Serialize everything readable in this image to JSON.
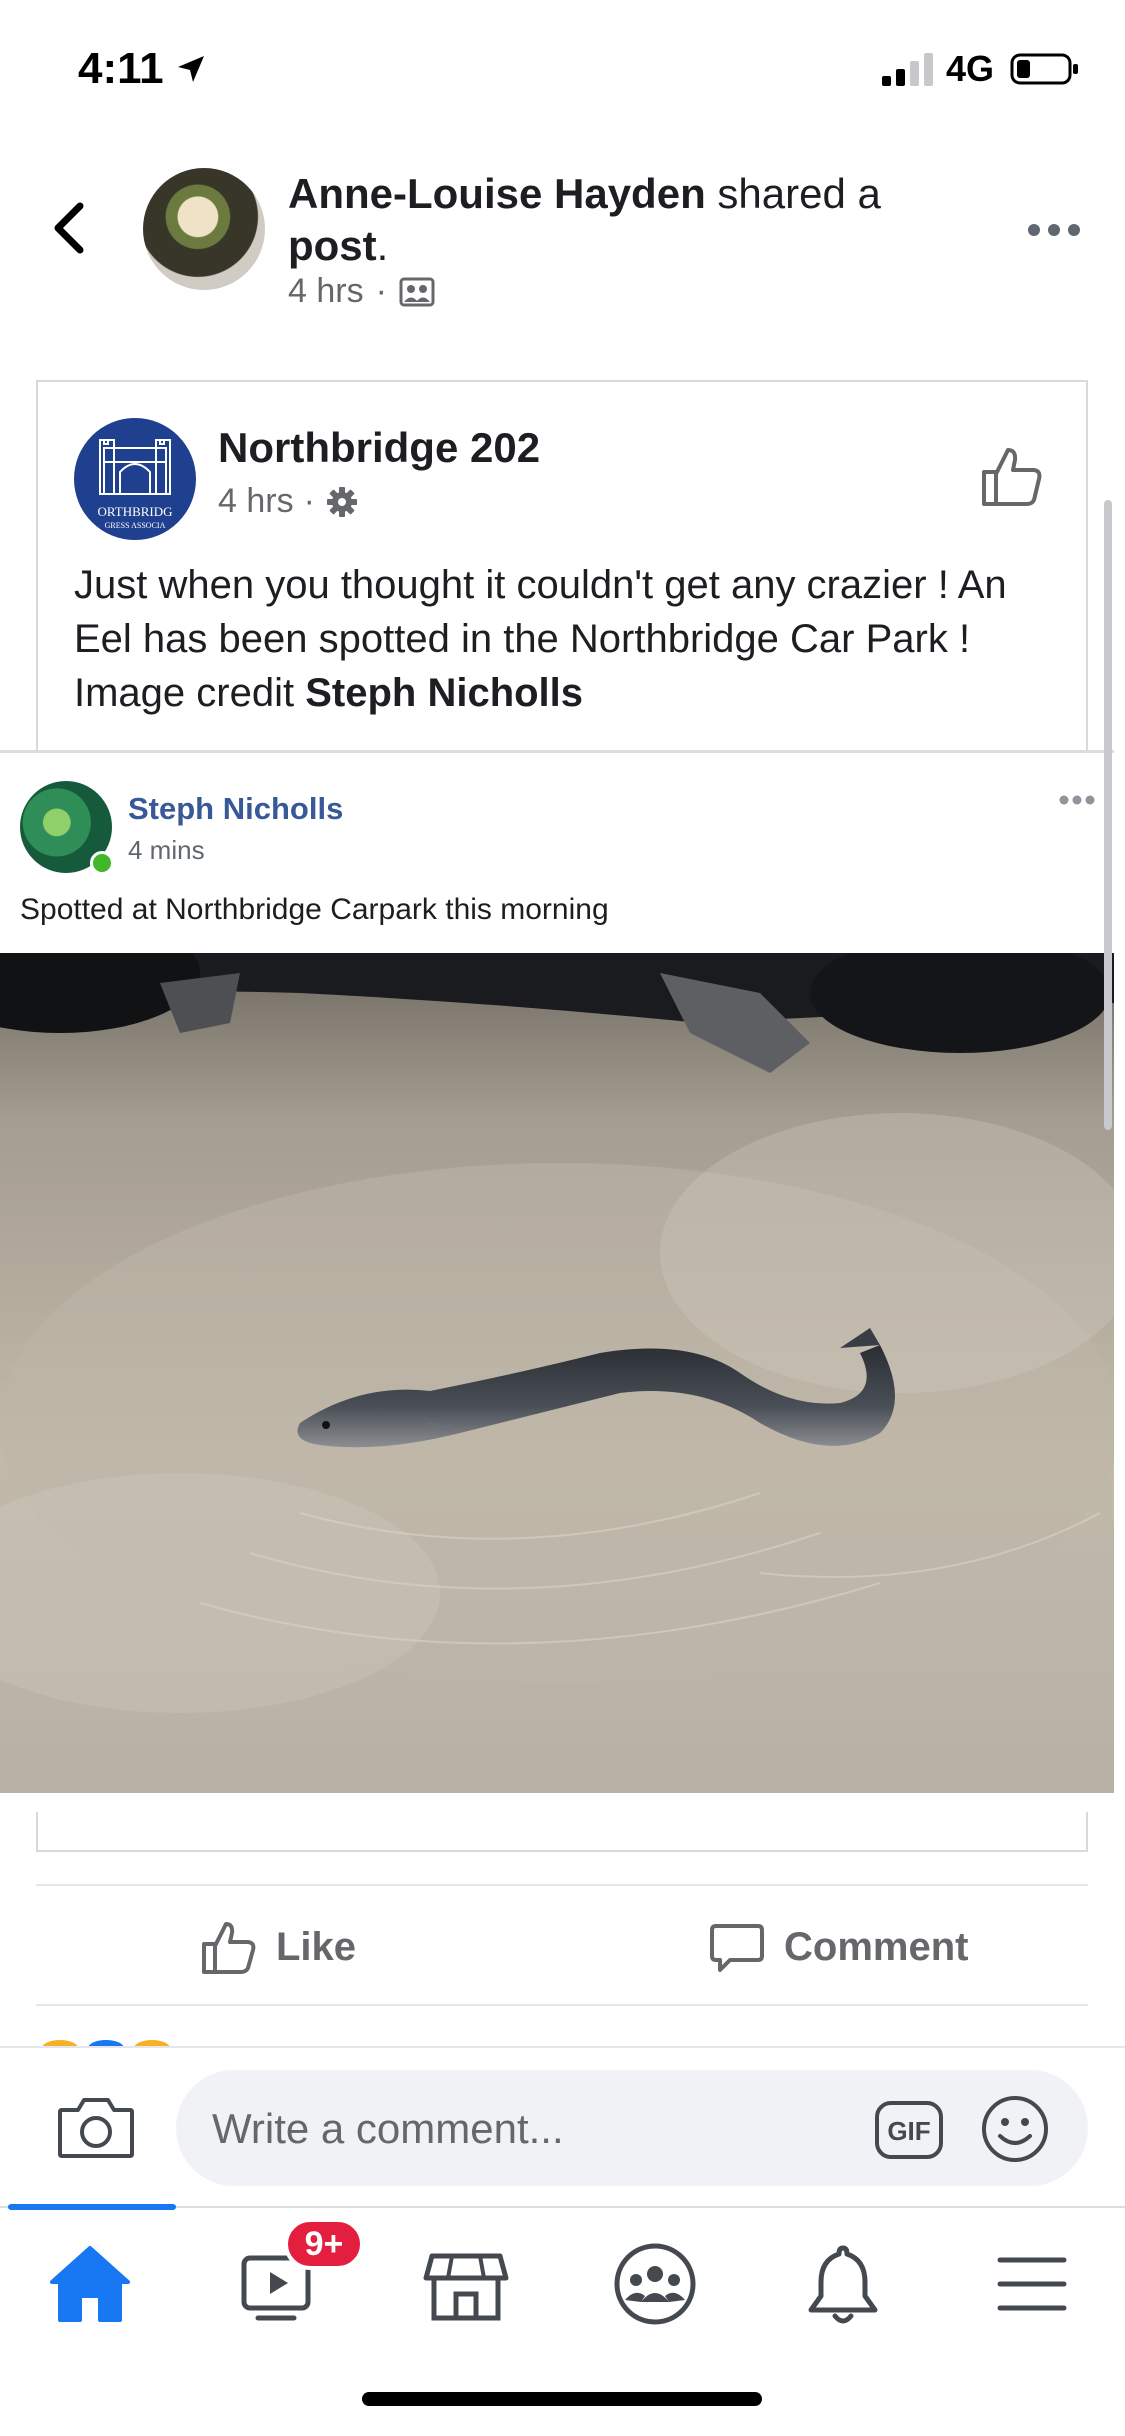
{
  "status_bar": {
    "time": "4:11",
    "network": "4G"
  },
  "share_header": {
    "sharer_name": "Anne-Louise Hayden",
    "action_text": " shared a ",
    "object_text": "post",
    "trailing": ".",
    "time": "4 hrs",
    "separator": "·"
  },
  "post": {
    "page_name": "Northbridge 202",
    "time": "4 hrs",
    "separator": "·",
    "logo_text": "ORTHBRIDG",
    "logo_subtext": "GRESS ASSOCIA",
    "body": "Just when you thought it couldn't get any crazier ! An Eel has been spotted in the Northbridge Car Park ! Image credit ",
    "credit": "Steph Nicholls"
  },
  "embedded": {
    "author": "Steph Nicholls",
    "time": "4 mins",
    "text": "Spotted at Northbridge Carpark this morning"
  },
  "actions": {
    "like_label": "Like",
    "comment_label": "Comment"
  },
  "comment_bar": {
    "placeholder": "Write a comment...",
    "gif_label": "GIF"
  },
  "tab_bar": {
    "video_badge": "9+"
  },
  "colors": {
    "accent": "#1877f2",
    "badge": "#e41e3f",
    "link_name": "#385898",
    "meta": "#65676b"
  }
}
